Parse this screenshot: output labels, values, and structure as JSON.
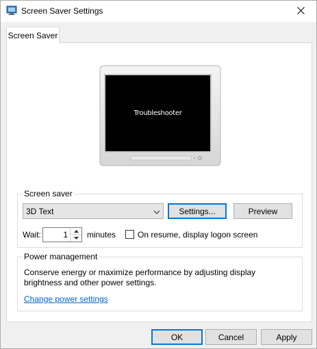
{
  "window": {
    "title": "Screen Saver Settings",
    "close_glyph": "✕"
  },
  "tabs": [
    {
      "label": "Screen Saver",
      "selected": true
    }
  ],
  "preview": {
    "screen_text": "Troubleshooter"
  },
  "screen_saver": {
    "group_label": "Screen saver",
    "selected": "3D Text",
    "settings_label": "Settings...",
    "preview_label": "Preview",
    "wait_label": "Wait:",
    "wait_value": "1",
    "minutes_label": "minutes",
    "resume_label": "On resume, display logon screen",
    "resume_checked": false
  },
  "power": {
    "group_label": "Power management",
    "description": "Conserve energy or maximize performance by adjusting display brightness and other power settings.",
    "link_label": "Change power settings"
  },
  "footer": {
    "ok_label": "OK",
    "cancel_label": "Cancel",
    "apply_label": "Apply"
  },
  "colors": {
    "accent": "#0078d7",
    "link": "#0066cc",
    "window_bg": "#f0f0f0",
    "panel_bg": "#ffffff"
  }
}
